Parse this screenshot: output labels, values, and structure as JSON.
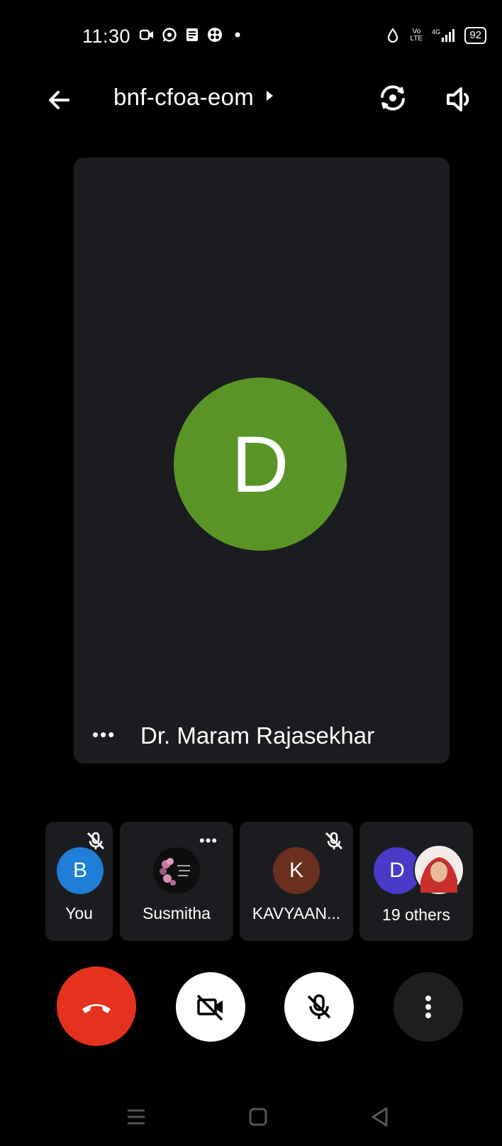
{
  "status_bar": {
    "time": "11:30",
    "battery": "92",
    "network": "4G",
    "volte": "Vo LTE"
  },
  "header": {
    "title": "bnf-cfoa-eom",
    "icons": [
      "back-arrow-icon",
      "chevron-right-icon",
      "switch-camera-icon",
      "speaker-icon"
    ]
  },
  "main_tile": {
    "initial": "D",
    "presenter_name": "Dr. Maram Rajasekhar",
    "more_label": "•••",
    "avatar_color": "#5a9427",
    "background": "#1b1c1f"
  },
  "participants": [
    {
      "name": "You",
      "initial": "B",
      "color": "#1f7fd8",
      "muted": true
    },
    {
      "name": "Susmitha",
      "image": "flower-avatar",
      "muted": false,
      "more": "•••"
    },
    {
      "name": "KAVYAAN...",
      "initial": "K",
      "color": "#6b2f1f",
      "muted": true
    },
    {
      "name": "19 others",
      "initial": "D",
      "color": "#4a3ac8",
      "extra": "photo-avatar"
    }
  ],
  "controls": {
    "end_call_color": "#e5321e",
    "camera_state": "off",
    "mic_state": "muted",
    "icons": [
      "end-call-icon",
      "camera-off-icon",
      "mic-off-icon",
      "more-vert-icon"
    ]
  },
  "nav_bar": {
    "icons": [
      "menu-icon",
      "home-icon",
      "back-triangle-icon"
    ]
  }
}
